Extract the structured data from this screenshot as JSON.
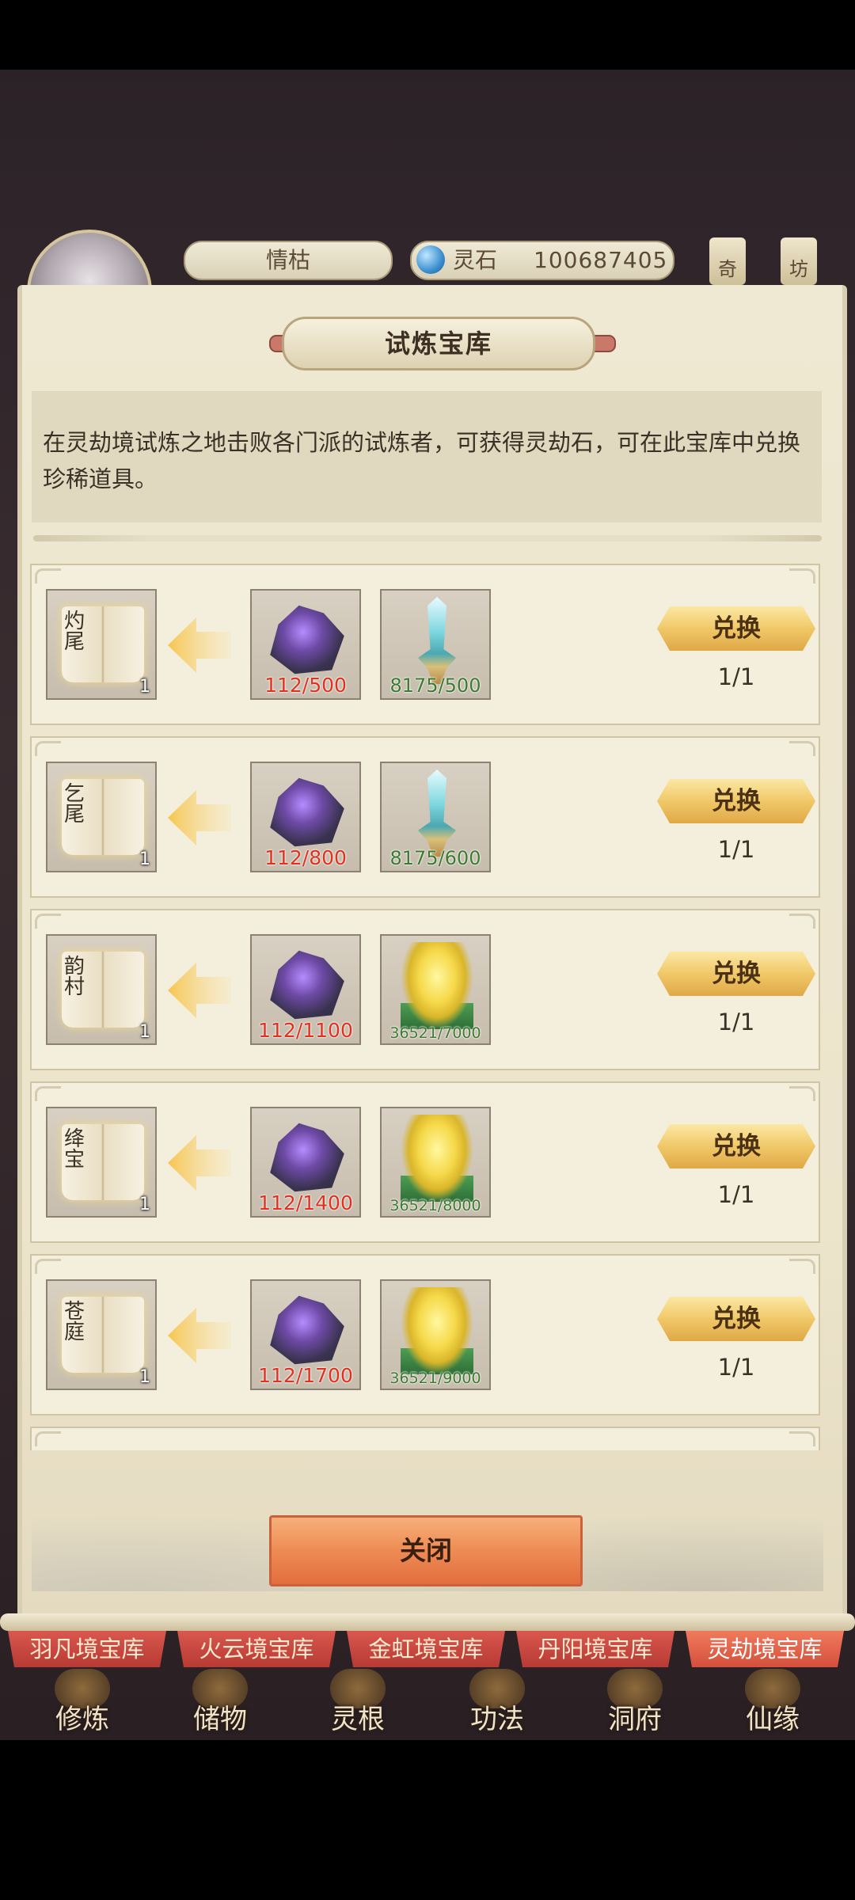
{
  "header": {
    "player_name": "情枯",
    "currency_label": "灵石",
    "currency_value": "100687405",
    "side_tags": [
      "奇",
      "坊"
    ]
  },
  "popup": {
    "title": "试炼宝库",
    "description": "在灵劫境试炼之地击败各门派的试炼者，可获得灵劫石，可在此宝库中兑换珍稀道具。",
    "close_label": "关闭",
    "items": [
      {
        "book_chars": "灼尾",
        "reward_qty": "1",
        "cost1": "112/500",
        "cost2": "8175/500",
        "cost2_icon": "sword-icon",
        "button": "兑换",
        "limit": "1/1"
      },
      {
        "book_chars": "乞尾",
        "reward_qty": "1",
        "cost1": "112/800",
        "cost2": "8175/600",
        "cost2_icon": "sword-icon",
        "button": "兑换",
        "limit": "1/1"
      },
      {
        "book_chars": "韵村",
        "reward_qty": "1",
        "cost1": "112/1100",
        "cost2": "36521/7000",
        "cost2_icon": "flame-icon",
        "button": "兑换",
        "limit": "1/1"
      },
      {
        "book_chars": "绛宝",
        "reward_qty": "1",
        "cost1": "112/1400",
        "cost2": "36521/8000",
        "cost2_icon": "flame-icon",
        "button": "兑换",
        "limit": "1/1"
      },
      {
        "book_chars": "苍庭",
        "reward_qty": "1",
        "cost1": "112/1700",
        "cost2": "36521/9000",
        "cost2_icon": "flame-icon",
        "button": "兑换",
        "limit": "1/1"
      }
    ]
  },
  "tabs": [
    "羽凡境宝库",
    "火云境宝库",
    "金虹境宝库",
    "丹阳境宝库",
    "灵劫境宝库"
  ],
  "active_tab": "灵劫境宝库",
  "bottom_nav": [
    "修炼",
    "储物",
    "灵根",
    "功法",
    "洞府",
    "仙缘"
  ],
  "colors": {
    "insufficient": "#e0301e",
    "sufficient": "#3c7a2e",
    "button_gold": "#f0c868",
    "close_orange": "#ee8b54",
    "tab_red": "#b73a34"
  }
}
